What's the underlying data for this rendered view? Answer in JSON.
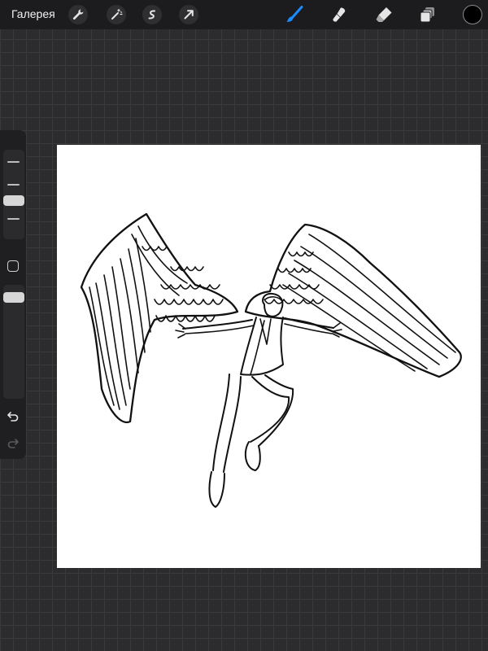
{
  "topbar": {
    "gallery_label": "Галерея",
    "actions_icons": [
      "wrench-icon",
      "magic-wand-icon",
      "selection-icon",
      "transform-arrow-icon"
    ],
    "tools_icons": [
      "brush-icon",
      "smudge-icon",
      "eraser-icon",
      "layers-icon"
    ],
    "active_tool": "brush",
    "accent_color": "#1a8cff",
    "current_color": "#000000"
  },
  "sidebar": {
    "brush_size_level": 0.55,
    "opacity_level": 1.0,
    "icons": [
      "modify-square-icon",
      "undo-icon",
      "redo-icon"
    ]
  },
  "canvas": {
    "content": "line-art-drawing",
    "background": "#ffffff"
  }
}
